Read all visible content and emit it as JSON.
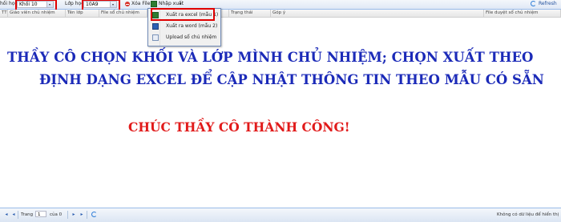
{
  "toolbar": {
    "khoi_label": "hối học:",
    "khoi_value": "Khối 10",
    "lop_label": "Lớp học:",
    "lop_value": "10A9",
    "delete_label": "Xóa File",
    "import_label": "Nhập xuất",
    "refresh_label": "Refresh"
  },
  "export_menu": {
    "items": [
      {
        "label": "Xuất ra excel (mẫu 1)",
        "icon": "excel-icon"
      },
      {
        "label": "Xuất ra word (mẫu 2)",
        "icon": "word-icon"
      },
      {
        "label": "Upload sổ chủ nhiệm",
        "icon": "upload-icon"
      }
    ]
  },
  "grid": {
    "columns": [
      "TT",
      "Giáo viên chủ nhiệm",
      "Tên lớp",
      "File sổ chủ nhiệm",
      "",
      "Trạng thái",
      "Góp ý",
      "File duyệt sổ chủ nhiệm"
    ]
  },
  "instructions": {
    "line1": "THẦY CÔ CHỌN KHỐI VÀ LỚP MÌNH CHỦ NHIỆM; CHỌN XUẤT THEO",
    "line2": "ĐỊNH DẠNG EXCEL ĐỂ CẬP NHẬT THÔNG TIN THEO MẪU CÓ SẴN",
    "line3": "CHÚC THẦY CÔ THÀNH CÔNG!"
  },
  "pager": {
    "page_label": "Trang",
    "page_value": "1",
    "of_label": "của 0",
    "empty_message": "Không có dữ liệu để hiển thị"
  },
  "colors": {
    "instruction_blue": "#1b2ab8",
    "instruction_red": "#e11a1a",
    "highlight_red": "#e00000"
  }
}
